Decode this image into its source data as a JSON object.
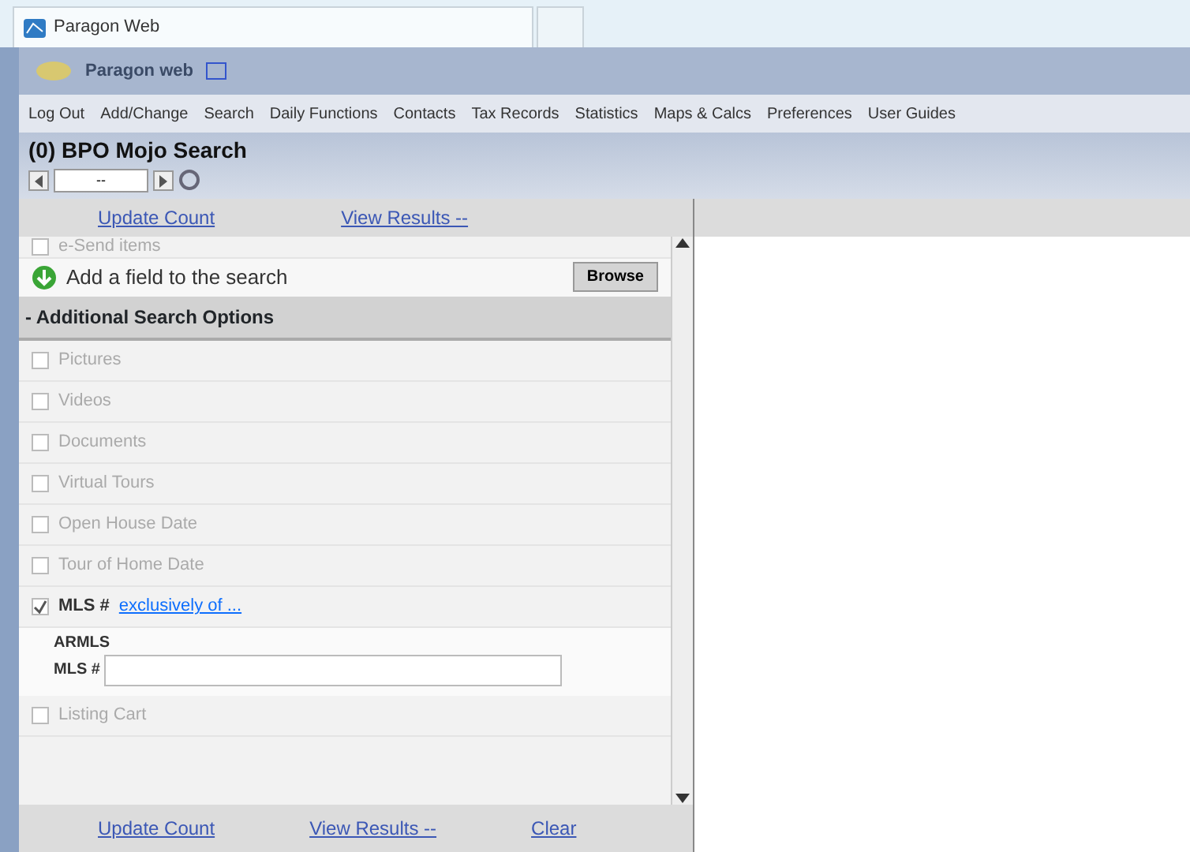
{
  "browser_tab": {
    "title": "Paragon Web"
  },
  "app_header": {
    "title": "Paragon web"
  },
  "menu": [
    "Log Out",
    "Add/Change",
    "Search",
    "Daily Functions",
    "Contacts",
    "Tax Records",
    "Statistics",
    "Maps & Calcs",
    "Preferences",
    "User Guides"
  ],
  "page_title": "(0) BPO Mojo Search",
  "pager": {
    "value": "--"
  },
  "top_actions": [
    "Update Count",
    "View Results --"
  ],
  "partial_item": {
    "label": "e-Send items",
    "checked": false
  },
  "add_field": {
    "label": "Add a field to the search",
    "button": "Browse"
  },
  "section": {
    "title": "- Additional Search Options"
  },
  "options": [
    {
      "kind": "check",
      "label": "Pictures",
      "checked": false
    },
    {
      "kind": "check",
      "label": "Videos",
      "checked": false
    },
    {
      "kind": "check",
      "label": "Documents",
      "checked": false
    },
    {
      "kind": "check",
      "label": "Virtual Tours",
      "checked": false
    },
    {
      "kind": "check",
      "label": "Open House Date",
      "checked": false
    },
    {
      "kind": "check",
      "label": "Tour of Home Date",
      "checked": false
    },
    {
      "kind": "expanded",
      "label": "MLS #",
      "link": "exclusively of ...",
      "checked": true,
      "sub_label": "ARMLS",
      "field_label": "MLS #"
    },
    {
      "kind": "check",
      "label": "Listing Cart",
      "checked": false
    }
  ],
  "bottom_actions": [
    "Update Count",
    "View Results --",
    "Clear"
  ]
}
